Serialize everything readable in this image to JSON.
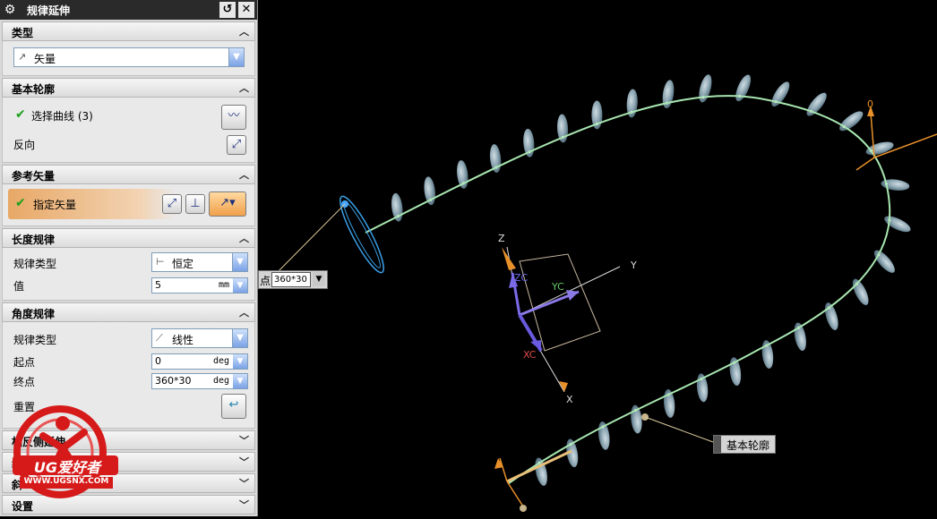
{
  "window": {
    "title": "规律延伸"
  },
  "sections": {
    "type": {
      "header": "类型",
      "value": "矢量"
    },
    "base": {
      "header": "基本轮廓",
      "select_label": "选择曲线 (3)",
      "reverse_label": "反向"
    },
    "ref": {
      "header": "参考矢量",
      "specify_label": "指定矢量"
    },
    "length": {
      "header": "长度规律",
      "law_label": "规律类型",
      "law_value": "恒定",
      "value_label": "值",
      "value": "5",
      "unit": "mm"
    },
    "angle": {
      "header": "角度规律",
      "law_label": "规律类型",
      "law_value": "线性",
      "start_label": "起点",
      "start_value": "0",
      "start_unit": "deg",
      "end_label": "终点",
      "end_value": "360*30",
      "end_unit": "deg",
      "reset_label": "重置"
    },
    "collapsed": [
      {
        "header": "相反侧延伸"
      },
      {
        "header": "线"
      },
      {
        "header": "斜"
      },
      {
        "header": "设置"
      }
    ]
  },
  "logo": {
    "text": "UG爱好者",
    "url": "WWW.UGSNX.COM"
  },
  "viewport": {
    "axes": {
      "z": "Z",
      "zc": "ZC",
      "y": "Y",
      "yc": "YC",
      "xc": "XC",
      "x": "X",
      "o": "0"
    },
    "float_field": {
      "prefix": "点",
      "value": "360*30"
    },
    "base_label": "基本轮廓"
  },
  "colors": {
    "accent_orange": "#e8a866",
    "curve": "#a8e6b0",
    "fin": "#9cb8c6"
  }
}
